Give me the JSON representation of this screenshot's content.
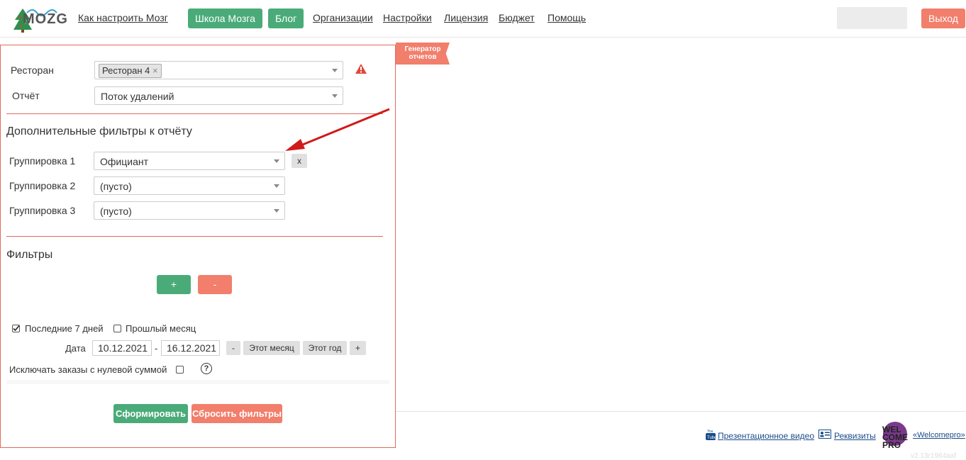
{
  "nav": {
    "logo_text": "MOZG",
    "how_to": "Как настроить Мозг",
    "school": "Школа Мозга",
    "blog": "Блог",
    "orgs": "Организации",
    "settings": "Настройки",
    "license": "Лицензия",
    "budget": "Бюджет",
    "help": "Помощь",
    "logout": "Выход"
  },
  "ribbon": {
    "line1": "Генератор",
    "line2": "отчетов"
  },
  "form": {
    "restaurant_label": "Ресторан",
    "restaurant_tag": "Ресторан 4",
    "restaurant_tag_remove": "×",
    "report_label": "Отчёт",
    "report_value": "Поток удалений"
  },
  "extra": {
    "title": "Дополнительные фильтры к отчёту",
    "groups": [
      {
        "label": "Группировка 1",
        "value": "Официант",
        "remove": "x"
      },
      {
        "label": "Группировка 2",
        "value": "(пусто)"
      },
      {
        "label": "Группировка 3",
        "value": "(пусто)"
      }
    ]
  },
  "filters": {
    "title": "Фильтры",
    "add": "+",
    "remove": "-"
  },
  "period": {
    "last7": "Последние 7 дней",
    "last7_checked": true,
    "last_month": "Прошлый месяц",
    "last_month_checked": false,
    "date_label": "Дата",
    "date_from": "10.12.2021",
    "date_sep": "-",
    "date_to": "16.12.2021",
    "minus": "-",
    "this_month": "Этот месяц",
    "this_year": "Этот год",
    "plus": "+",
    "exclude_zero": "Исключать заказы с нулевой суммой",
    "exclude_zero_checked": false,
    "help": "?"
  },
  "actions": {
    "build": "Сформировать",
    "reset": "Сбросить фильтры"
  },
  "footer": {
    "video": "Презентационное видео",
    "requisites": "Реквизиты",
    "welcome_logo": [
      "WEL",
      "COME",
      "PRO"
    ],
    "welcome_link": "«Welcomepro»",
    "version": "v2.13r1984aaf"
  },
  "colors": {
    "green": "#4aab79",
    "red": "#f27e6c",
    "border_red": "#e06a5c",
    "arrow": "#d11a1a",
    "purple": "#7a3a8c"
  },
  "icons": [
    "tree-icon",
    "warning-icon",
    "caret-down-icon",
    "checkbox-icon",
    "help-icon",
    "youtube-icon",
    "id-card-icon"
  ]
}
